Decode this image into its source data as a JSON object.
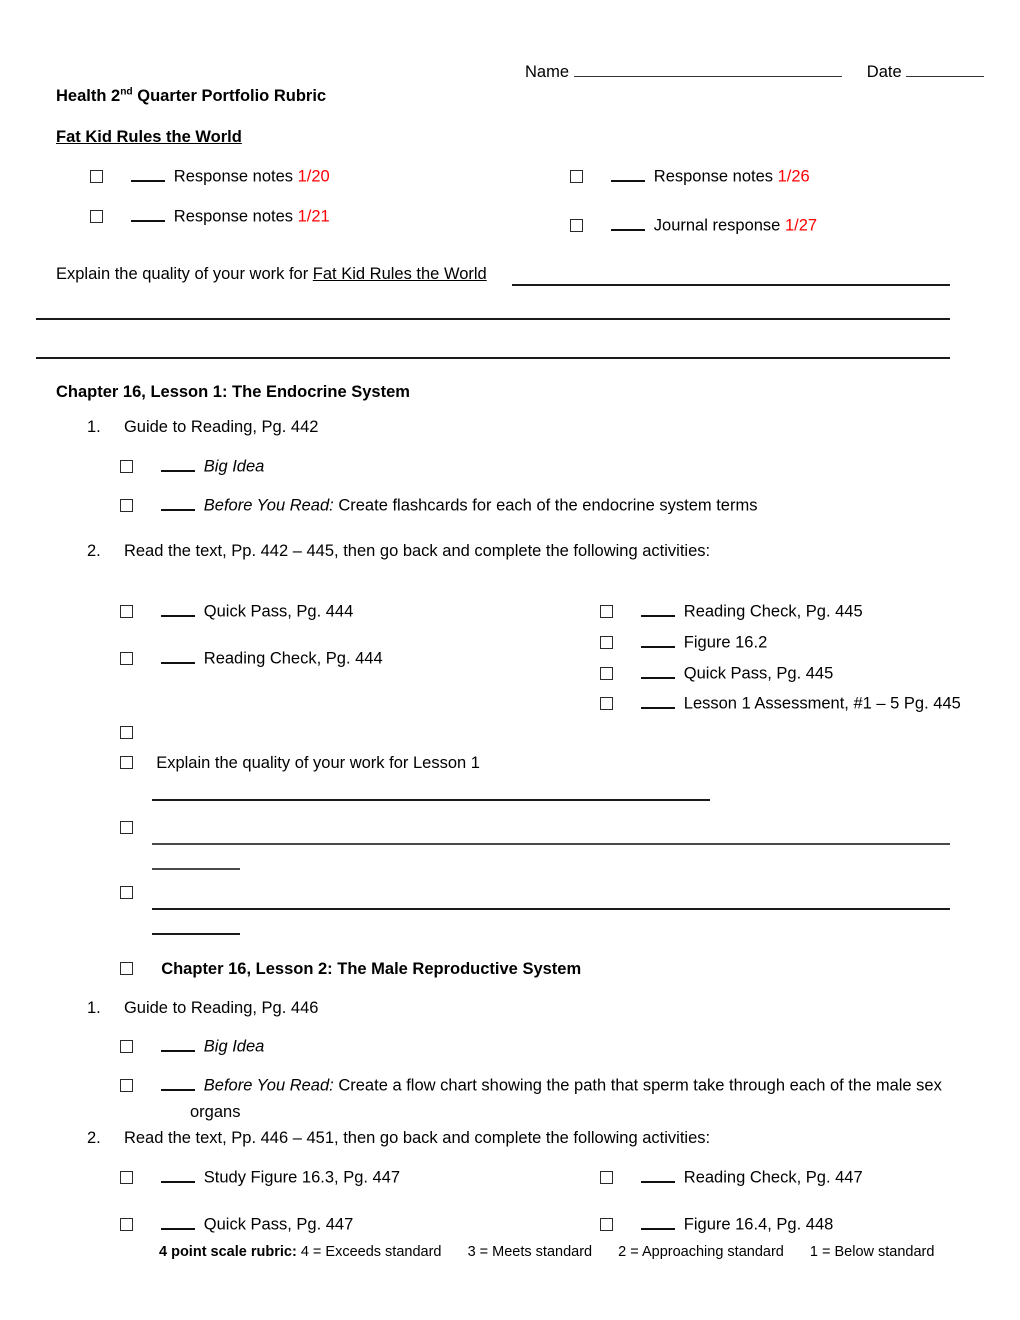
{
  "document": {
    "title": "Health 2 Quarter Portfolio Rubric",
    "title_pre": "Health 2",
    "title_sup": "nd",
    "title_post": " Quarter Portfolio Rubric",
    "header": {
      "name_label": "Name",
      "date_label": "Date"
    },
    "section_fat_kid": {
      "heading": "Fat Kid Rules the World",
      "items_left": [
        {
          "blank": "____",
          "label": "Response notes",
          "date": "1/20"
        },
        {
          "blank": "____",
          "label": "Response notes",
          "date": "1/21"
        }
      ],
      "items_right": [
        {
          "blank": "____",
          "label": "Response notes",
          "date": "1/26"
        },
        {
          "blank": "____",
          "label": "Journal response",
          "date": "1/27"
        }
      ],
      "explain_prefix": "Explain the quality of your work for ",
      "explain_subject": "Fat Kid Rules the World"
    },
    "section_lesson1": {
      "heading": "Chapter 16, Lesson 1: The Endocrine System",
      "item1_number": "1.",
      "item1_text": "Guide to Reading, Pg. 442",
      "item1_checks": [
        {
          "blank": "____",
          "italic": "Big Idea",
          "rest": ""
        },
        {
          "blank": "____",
          "italic": "Before You Read:",
          "rest": " Create flashcards for each of the endocrine system terms"
        }
      ],
      "item2_number": "2.",
      "item2_text": "Read the text, Pp. 442 – 445, then go back and complete the following activities:",
      "item2_left": [
        {
          "blank": "____",
          "label": "Quick Pass, Pg. 444"
        },
        {
          "blank": "____",
          "label": "Reading Check, Pg. 444"
        }
      ],
      "item2_right": [
        {
          "blank": "____",
          "label": "Reading Check, Pg. 445"
        },
        {
          "blank": "____",
          "label": "Figure 16.2"
        },
        {
          "blank": "____",
          "label": "Quick Pass, Pg. 445"
        },
        {
          "blank": "____",
          "label": "Lesson 1 Assessment, #1 – 5 Pg. 445"
        }
      ],
      "empty_check_label": "",
      "explain_label": "Explain the quality of your work for Lesson 1"
    },
    "section_lesson2": {
      "heading": "Chapter 16, Lesson 2: The Male Reproductive System",
      "item1_number": "1.",
      "item1_text": "Guide to Reading, Pg. 446",
      "item1_checks": [
        {
          "blank": "____",
          "italic": "Big Idea",
          "rest": ""
        },
        {
          "blank": "____",
          "italic": "Before You Read:",
          "rest": " Create a flow chart showing the path that sperm take through each of the male sex"
        }
      ],
      "item1_wrap": "organs",
      "item2_number": "2.",
      "item2_text": "Read the text, Pp. 446 – 451, then go back and complete the following activities:",
      "item2_left": [
        {
          "blank": "____",
          "label": "Study Figure 16.3, Pg. 447"
        },
        {
          "blank": "____",
          "label": "Quick Pass, Pg. 447"
        }
      ],
      "item2_right": [
        {
          "blank": "____",
          "label": "Reading Check, Pg. 447"
        },
        {
          "blank": "____",
          "label": "Figure 16.4, Pg. 448"
        }
      ]
    },
    "footer": {
      "bold_part": "4 point scale rubric:",
      "scale_4": "4 = Exceeds standard",
      "scale_3": "3 = Meets standard",
      "scale_2": "2 = Approaching standard",
      "scale_1": "1 = Below standard"
    },
    "colors": {
      "date_red": "#FF0000",
      "text": "#000000",
      "rule": "#1a1a1a"
    }
  }
}
